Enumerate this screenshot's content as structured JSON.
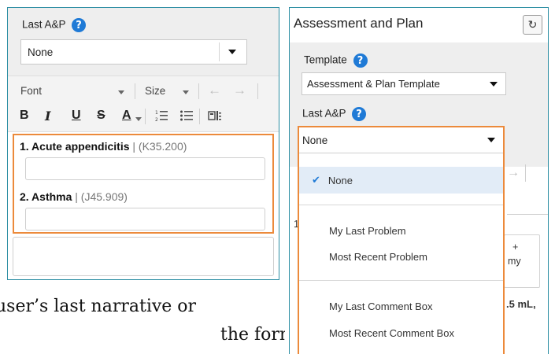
{
  "left_panel": {
    "last_ap_label": "Last A&P",
    "help_glyph": "?",
    "select_value": "None",
    "toolbar": {
      "font_label": "Font",
      "size_label": "Size",
      "bold": "B",
      "italic": "I",
      "underline": "U",
      "strike": "S",
      "font_color": "A",
      "undo_icon": "undo-icon",
      "redo_icon": "redo-icon"
    },
    "problems": [
      {
        "name": "1. Acute appendicitis",
        "code": "| (K35.200)"
      },
      {
        "name": "2. Asthma",
        "code": "| (J45.909)"
      }
    ]
  },
  "paragraph": {
    "line1": "user’s last narrative or",
    "line2": "the form. Fi"
  },
  "right_panel": {
    "title": "Assessment and Plan",
    "refresh_glyph": "↻",
    "template_label": "Template",
    "template_value": "Assessment & Plan Template",
    "last_ap_label": "Last A&P",
    "dropdown": {
      "selected_value": "None",
      "options": [
        {
          "label": "None",
          "selected": true
        },
        {
          "label": "My Last Problem",
          "selected": false
        },
        {
          "label": "Most Recent Problem",
          "selected": false
        },
        {
          "label": "My Last Comment Box",
          "selected": false
        },
        {
          "label": "Most Recent Comment Box",
          "selected": false
        }
      ]
    },
    "background_fragments": {
      "item_number": "1",
      "plus": "+",
      "my_fragment": "my",
      "dose_fragment": ".5 mL,"
    }
  },
  "colors": {
    "panel_border": "#2c8ea3",
    "highlight_orange": "#ec8a3b",
    "help_blue": "#1f7ad6",
    "selected_row": "#e2ecf7"
  }
}
